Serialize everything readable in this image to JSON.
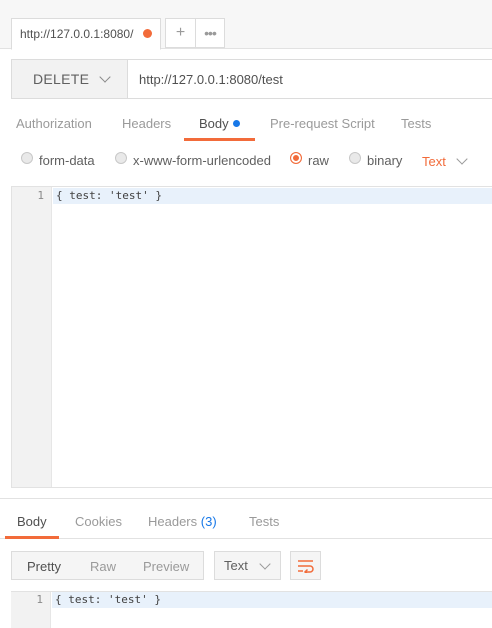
{
  "tab": {
    "label": "http://127.0.0.1:8080/",
    "new_tab": "+",
    "more": "•••"
  },
  "request": {
    "method": "DELETE",
    "url": "http://127.0.0.1:8080/test"
  },
  "request_tabs": {
    "authorization": "Authorization",
    "headers": "Headers",
    "body": "Body",
    "prerequest": "Pre-request Script",
    "tests": "Tests"
  },
  "body_modes": {
    "form_data": "form-data",
    "urlencoded": "x-www-form-urlencoded",
    "raw": "raw",
    "binary": "binary",
    "selected": "raw",
    "content_type": "Text"
  },
  "request_body": {
    "line_number": "1",
    "code": "{ test: 'test' }"
  },
  "response_tabs": {
    "body": "Body",
    "cookies": "Cookies",
    "headers": "Headers",
    "headers_count": "(3)",
    "tests": "Tests"
  },
  "response_toolbar": {
    "pretty": "Pretty",
    "raw": "Raw",
    "preview": "Preview",
    "format": "Text"
  },
  "response_body": {
    "line_number": "1",
    "code": "{ test: 'test' }"
  },
  "colors": {
    "accent": "#f26b3a",
    "link_blue": "#1778e8"
  },
  "icons": {
    "method_dropdown": "chevron-down-icon",
    "content_type_dropdown": "chevron-down-icon",
    "wrap": "wrap-lines-icon"
  }
}
